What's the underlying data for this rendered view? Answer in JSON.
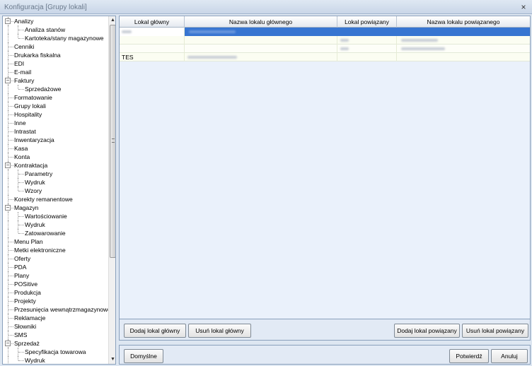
{
  "window": {
    "title": "Konfiguracja [Grupy lokali]",
    "close_glyph": "×"
  },
  "tree": {
    "items": [
      {
        "label": "Analizy",
        "level": 0,
        "expander": "−"
      },
      {
        "label": "Analiza stanów",
        "level": 1
      },
      {
        "label": "Kartoteka/stany magazynowe",
        "level": 1
      },
      {
        "label": "Cenniki",
        "level": 0
      },
      {
        "label": "Drukarka fiskalna",
        "level": 0
      },
      {
        "label": "EDI",
        "level": 0
      },
      {
        "label": "E-mail",
        "level": 0
      },
      {
        "label": "Faktury",
        "level": 0,
        "expander": "−"
      },
      {
        "label": "Sprzedażowe",
        "level": 1
      },
      {
        "label": "Formatowanie",
        "level": 0
      },
      {
        "label": "Grupy lokali",
        "level": 0
      },
      {
        "label": "Hospitality",
        "level": 0
      },
      {
        "label": "Inne",
        "level": 0
      },
      {
        "label": "Intrastat",
        "level": 0
      },
      {
        "label": "Inwentaryzacja",
        "level": 0
      },
      {
        "label": "Kasa",
        "level": 0
      },
      {
        "label": "Konta",
        "level": 0
      },
      {
        "label": "Kontraktacja",
        "level": 0,
        "expander": "−"
      },
      {
        "label": "Parametry",
        "level": 1
      },
      {
        "label": "Wydruk",
        "level": 1
      },
      {
        "label": "Wzory",
        "level": 1
      },
      {
        "label": "Korekty remanentowe",
        "level": 0
      },
      {
        "label": "Magazyn",
        "level": 0,
        "expander": "−"
      },
      {
        "label": "Wartościowanie",
        "level": 1
      },
      {
        "label": "Wydruk",
        "level": 1
      },
      {
        "label": "Zatowarowanie",
        "level": 1
      },
      {
        "label": "Menu Plan",
        "level": 0
      },
      {
        "label": "Metki elektroniczne",
        "level": 0
      },
      {
        "label": "Oferty",
        "level": 0
      },
      {
        "label": "PDA",
        "level": 0
      },
      {
        "label": "Plany",
        "level": 0
      },
      {
        "label": "POSitive",
        "level": 0
      },
      {
        "label": "Produkcja",
        "level": 0
      },
      {
        "label": "Projekty",
        "level": 0
      },
      {
        "label": "Przesunięcia wewnątrzmagazynowe",
        "level": 0
      },
      {
        "label": "Reklamacje",
        "level": 0
      },
      {
        "label": "Słowniki",
        "level": 0
      },
      {
        "label": "SMS",
        "level": 0
      },
      {
        "label": "Sprzedaż",
        "level": 0,
        "expander": "−"
      },
      {
        "label": "Specyfikacja towarowa",
        "level": 1
      },
      {
        "label": "Wydruk",
        "level": 1
      }
    ],
    "scroll_up_glyph": "▲",
    "scroll_down_glyph": "▼"
  },
  "grid": {
    "columns": [
      "Lokal główny",
      "Nazwa lokalu głównego",
      "Lokal powiązany",
      "Nazwa lokalu powiązanego"
    ],
    "rows": [
      {
        "lokal_glowny": "",
        "nazwa_glownego": "",
        "lokal_powiazany": "",
        "nazwa_powiazanego": "",
        "selected": true
      },
      {
        "lokal_glowny": "",
        "nazwa_glownego": "",
        "lokal_powiazany": "",
        "nazwa_powiazanego": ""
      },
      {
        "lokal_glowny": "",
        "nazwa_glownego": "",
        "lokal_powiazany": "",
        "nazwa_powiazanego": ""
      },
      {
        "lokal_glowny": "TES",
        "nazwa_glownego": "",
        "lokal_powiazany": "",
        "nazwa_powiazanego": ""
      }
    ],
    "selection_color": "#3775d1"
  },
  "buttons": {
    "add_main": "Dodaj lokal główny",
    "remove_main": "Usuń lokal główny",
    "add_related": "Dodaj lokal powiązany",
    "remove_related": "Usuń lokal powiązany",
    "defaults": "Domyślne",
    "confirm": "Potwierdź",
    "cancel": "Anuluj"
  }
}
